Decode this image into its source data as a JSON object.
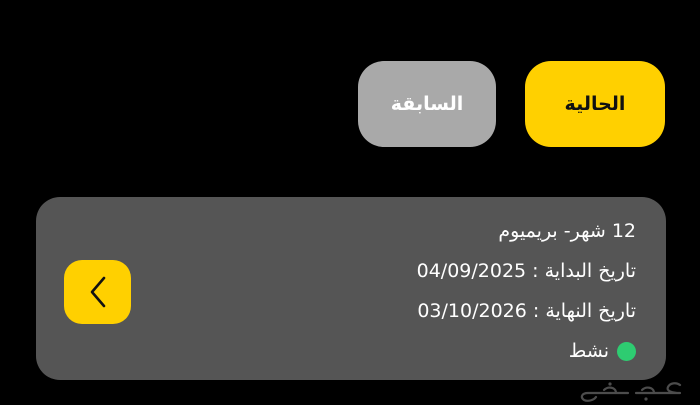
{
  "tabs": {
    "current": "الحالية",
    "previous": "السابقة"
  },
  "subscription": {
    "plan": "12 شهر- بريميوم",
    "start": "تاريخ البداية : 04/09/2025",
    "end": "تاريخ النهاية : 03/10/2026",
    "status": "نشط"
  },
  "colors": {
    "accent": "#FFD000",
    "inactive_tab": "#A9A9A9",
    "card": "#555555",
    "status_active": "#2ECC71"
  },
  "icons": {
    "nav": "chevron-left-icon",
    "status": "status-dot-icon",
    "watermark": "haraj-logo"
  }
}
